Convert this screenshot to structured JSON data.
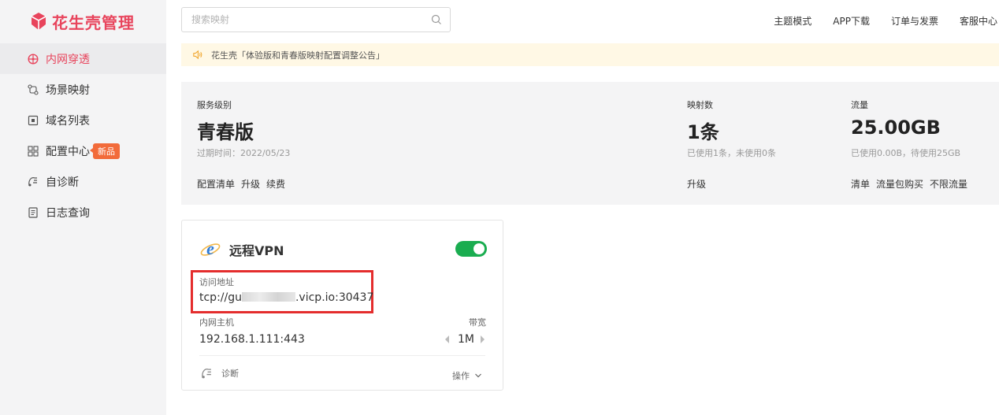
{
  "brand": {
    "logo_text": "花生壳管理",
    "accent": "#e8445c"
  },
  "sidebar": {
    "items": [
      {
        "label": "内网穿透",
        "icon": "network-icon",
        "active": true
      },
      {
        "label": "场景映射",
        "icon": "scene-icon"
      },
      {
        "label": "域名列表",
        "icon": "domain-icon"
      },
      {
        "label": "配置中心",
        "icon": "grid-icon",
        "badge": "新品"
      },
      {
        "label": "自诊断",
        "icon": "diagnose-icon"
      },
      {
        "label": "日志查询",
        "icon": "log-icon"
      }
    ]
  },
  "header": {
    "search_placeholder": "搜索映射",
    "links": [
      "主题模式",
      "APP下载",
      "订单与发票",
      "客服中心"
    ]
  },
  "notice": {
    "text": "花生壳「体验版和青春版映射配置调整公告」"
  },
  "stats": {
    "service": {
      "label": "服务级别",
      "value": "青春版",
      "sub": "过期时间：2022/05/23",
      "links": [
        "配置清单",
        "升级",
        "续费"
      ]
    },
    "mappings": {
      "label": "映射数",
      "value": "1条",
      "sub": "已使用1条，未使用0条",
      "links": [
        "升级"
      ]
    },
    "traffic": {
      "label": "流量",
      "value": "25.00GB",
      "sub": "已使用0.00B，待使用25GB",
      "links": [
        "清单",
        "流量包购买",
        "不限流量"
      ]
    }
  },
  "card": {
    "title": "远程VPN",
    "enabled": true,
    "address_label": "访问地址",
    "address_prefix": "tcp://gu",
    "address_suffix": ".vicp.io:30437",
    "host_label": "内网主机",
    "host_value": "192.168.1.111:443",
    "bandwidth_label": "带宽",
    "bandwidth_value": "1M",
    "diagnose_label": "诊断",
    "ops_label": "操作",
    "toggle_color": "#1aad50",
    "highlight_color": "#e42d2d"
  }
}
